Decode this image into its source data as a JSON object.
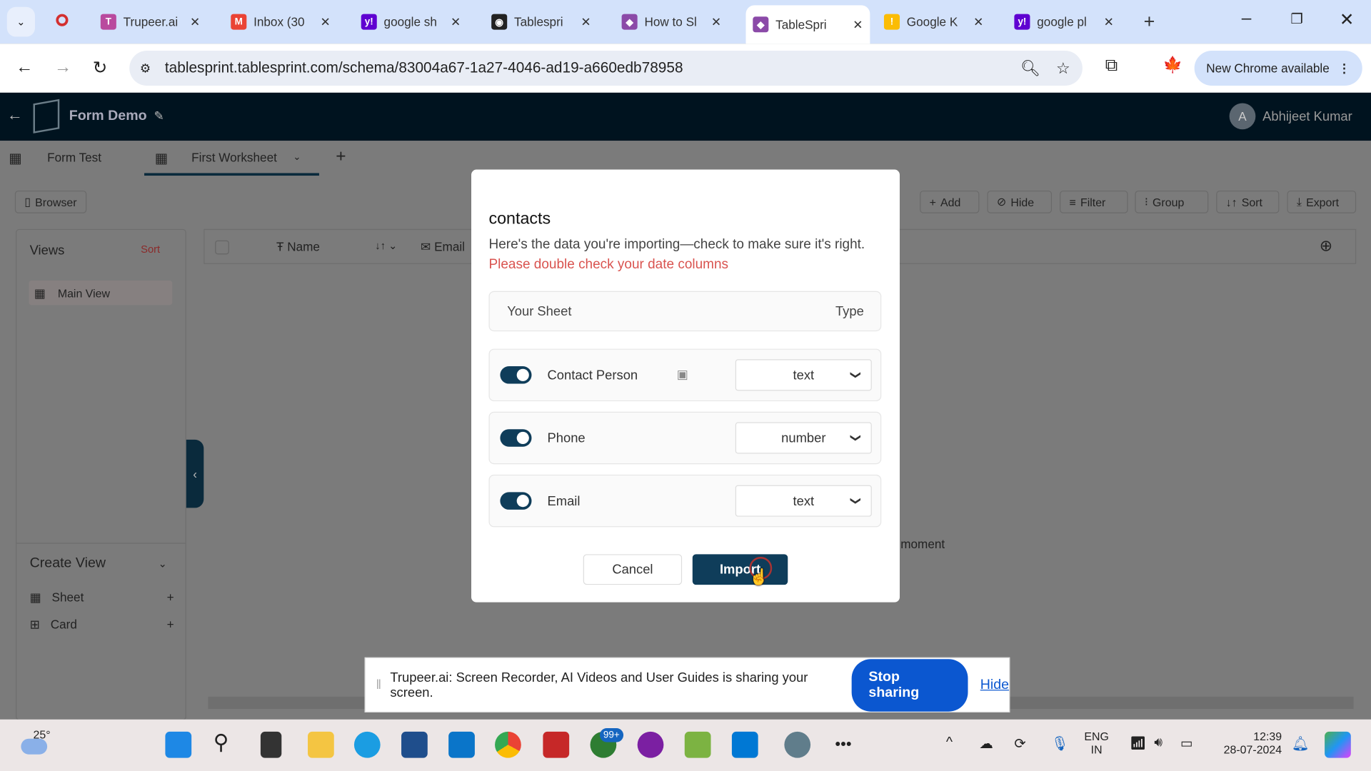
{
  "browser": {
    "tabs": [
      {
        "label": "Trupeer.ai",
        "color": "#b94a9e",
        "glyph": "T"
      },
      {
        "label": "Inbox (30",
        "color": "#ea4335",
        "glyph": "M"
      },
      {
        "label": "google sh",
        "color": "#5f01d1",
        "glyph": "y!"
      },
      {
        "label": "Tablespri",
        "color": "#222",
        "glyph": "◉"
      },
      {
        "label": "How to Sl",
        "color": "#8b4aa8",
        "glyph": "◆"
      },
      {
        "label": "TableSpri",
        "color": "#8b4aa8",
        "glyph": "◆"
      },
      {
        "label": "Google K",
        "color": "#fbbc04",
        "glyph": "!"
      },
      {
        "label": "google pl",
        "color": "#5f01d1",
        "glyph": "y!"
      }
    ],
    "url": "tablesprint.tablesprint.com/schema/83004a67-1a27-4046-ad19-a660edb78958",
    "new_chrome": "New Chrome available"
  },
  "app": {
    "title": "Form Demo",
    "user_initial": "A",
    "user_name": "Abhijeet Kumar",
    "sheet_tabs": [
      "Form Test",
      "First Worksheet"
    ],
    "browser_btn": "Browser",
    "toolbar": [
      "Add",
      "Hide",
      "Filter",
      "Group",
      "Sort",
      "Export"
    ],
    "views_title": "Views",
    "views_sort": "Sort",
    "main_view": "Main View",
    "columns": [
      "Name",
      "Email"
    ],
    "bg_text": "moment",
    "create_view": "Create View",
    "create_items": [
      "Sheet",
      "Card"
    ]
  },
  "modal": {
    "title": "contacts",
    "subtitle": "Here's the data you're importing—check to make sure it's right.",
    "warning": "Please double check your date columns",
    "header_sheet": "Your Sheet",
    "header_type": "Type",
    "rows": [
      {
        "name": "Contact Person",
        "type": "text",
        "enabled": true
      },
      {
        "name": "Phone",
        "type": "number",
        "enabled": true
      },
      {
        "name": "Email",
        "type": "text",
        "enabled": true
      }
    ],
    "cancel": "Cancel",
    "import": "Import"
  },
  "share_bar": {
    "text": "Trupeer.ai: Screen Recorder, AI Videos and User Guides is sharing your screen.",
    "stop": "Stop sharing",
    "hide": "Hide"
  },
  "taskbar": {
    "weather": "25°",
    "badge": "99+",
    "lang1": "ENG",
    "lang2": "IN",
    "time": "12:39",
    "date": "28-07-2024"
  }
}
